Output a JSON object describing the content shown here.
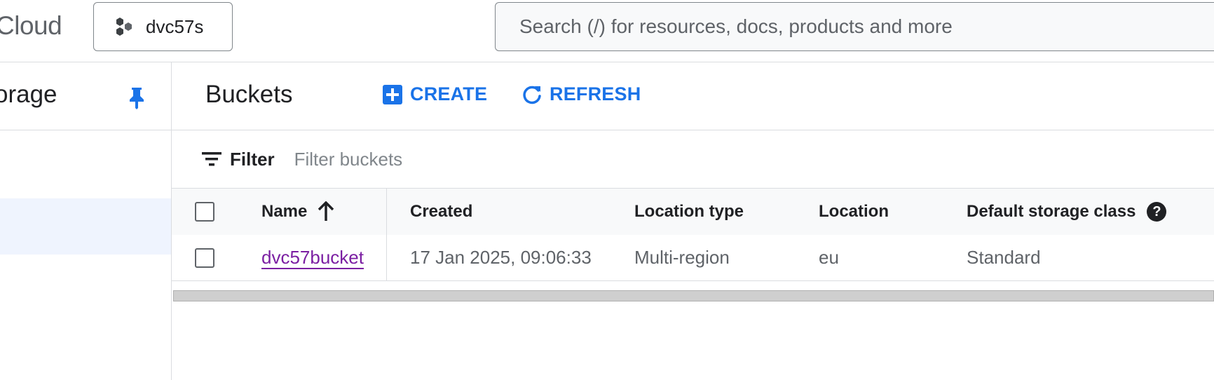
{
  "header": {
    "brand": "Cloud",
    "project": {
      "name": "dvc57s",
      "icon": "project-hexagons-icon"
    },
    "search": {
      "placeholder": "Search (/) for resources, docs, products and more",
      "value": ""
    }
  },
  "sidebar": {
    "title": "orage",
    "pin_icon": "pin-icon"
  },
  "page": {
    "title": "Buckets",
    "actions": [
      {
        "label": "CREATE",
        "icon": "add-box-icon"
      },
      {
        "label": "REFRESH",
        "icon": "refresh-icon"
      }
    ]
  },
  "filter": {
    "label": "Filter",
    "placeholder": "Filter buckets",
    "icon": "filter-list-icon"
  },
  "table": {
    "columns": [
      "Name",
      "Created",
      "Location type",
      "Location",
      "Default storage class"
    ],
    "sort": {
      "column": "Name",
      "direction": "ascending",
      "icon": "arrow-up-icon"
    },
    "rows": [
      {
        "name": "dvc57bucket",
        "created": "17 Jan 2025, 09:06:33",
        "location_type": "Multi-region",
        "location": "eu",
        "storage_class": "Standard"
      }
    ]
  },
  "colors": {
    "accent": "#1a73e8",
    "visited_link": "#7b1fa2",
    "border": "#dadce0",
    "muted": "#5f6368"
  }
}
